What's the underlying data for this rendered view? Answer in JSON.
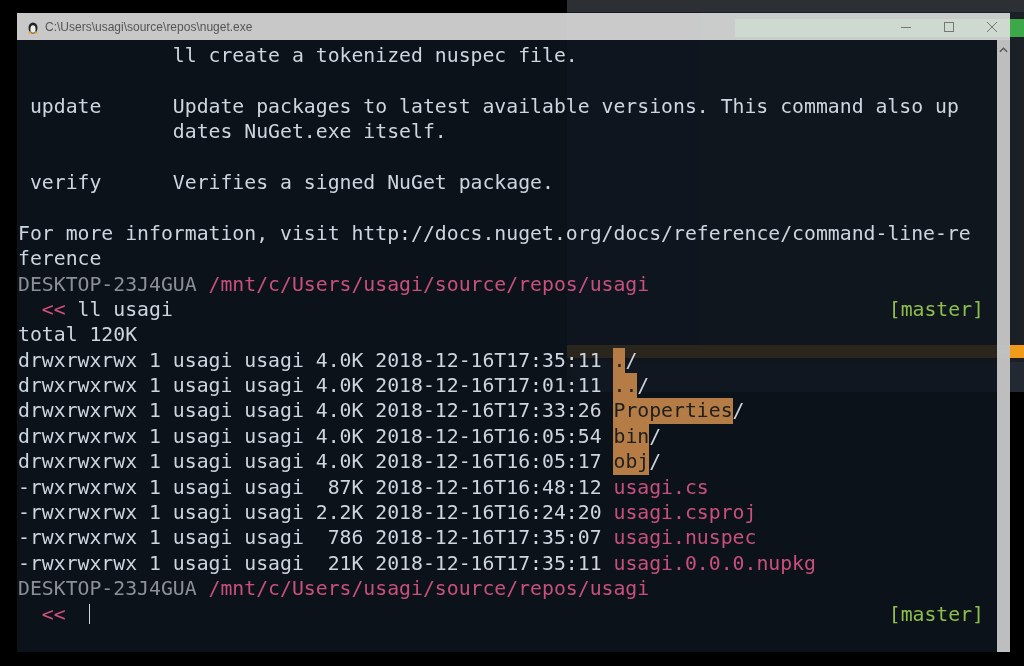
{
  "window": {
    "title": "C:\\Users\\usagi\\source\\repos\\nuget.exe"
  },
  "lines": [
    {
      "kind": "help",
      "text": "ll create a tokenized nuspec file."
    },
    {
      "kind": "blank"
    },
    {
      "kind": "help",
      "command": "update",
      "text": "Update packages to latest available versions. This command also up"
    },
    {
      "kind": "help",
      "text": "dates NuGet.exe itself."
    },
    {
      "kind": "blank"
    },
    {
      "kind": "help",
      "command": "verify",
      "text": "Verifies a signed NuGet package."
    },
    {
      "kind": "blank"
    },
    {
      "kind": "text",
      "text": "For more information, visit http://docs.nuget.org/docs/reference/command-line-re"
    },
    {
      "kind": "text",
      "text": "ference"
    },
    {
      "kind": "host",
      "host": "DESKTOP-23J4GUA",
      "path": "/mnt/c/Users/usagi/source/repos/usagi"
    },
    {
      "kind": "prompt",
      "prompt": "<<",
      "command": "ll usagi",
      "branch": "[master]"
    },
    {
      "kind": "text",
      "text": "total 120K"
    },
    {
      "kind": "dir_entry",
      "info": "drwxrwxrwx 1 usagi usagi 4.0K 2018-12-16T17:35:11",
      "name": ".",
      "suffix": "/"
    },
    {
      "kind": "dir_entry",
      "info": "drwxrwxrwx 1 usagi usagi 4.0K 2018-12-16T17:01:11",
      "name": "..",
      "suffix": "/"
    },
    {
      "kind": "dir_entry",
      "info": "drwxrwxrwx 1 usagi usagi 4.0K 2018-12-16T17:33:26",
      "name": "Properties",
      "suffix": "/"
    },
    {
      "kind": "dir_entry",
      "info": "drwxrwxrwx 1 usagi usagi 4.0K 2018-12-16T16:05:54",
      "name": "bin",
      "suffix": "/"
    },
    {
      "kind": "dir_entry",
      "info": "drwxrwxrwx 1 usagi usagi 4.0K 2018-12-16T16:05:17",
      "name": "obj",
      "suffix": "/"
    },
    {
      "kind": "file_entry",
      "info": "-rwxrwxrwx 1 usagi usagi  87K 2018-12-16T16:48:12",
      "name": "usagi.cs"
    },
    {
      "kind": "file_entry",
      "info": "-rwxrwxrwx 1 usagi usagi 2.2K 2018-12-16T16:24:20",
      "name": "usagi.csproj"
    },
    {
      "kind": "file_entry",
      "info": "-rwxrwxrwx 1 usagi usagi  786 2018-12-16T17:35:07",
      "name": "usagi.nuspec"
    },
    {
      "kind": "file_entry",
      "info": "-rwxrwxrwx 1 usagi usagi  21K 2018-12-16T17:35:11",
      "name": "usagi.0.0.0.nupkg"
    },
    {
      "kind": "host",
      "host": "DESKTOP-23J4GUA",
      "path": "/mnt/c/Users/usagi/source/repos/usagi"
    },
    {
      "kind": "prompt",
      "prompt": "<<",
      "cursor": true,
      "branch": "[master]"
    }
  ]
}
